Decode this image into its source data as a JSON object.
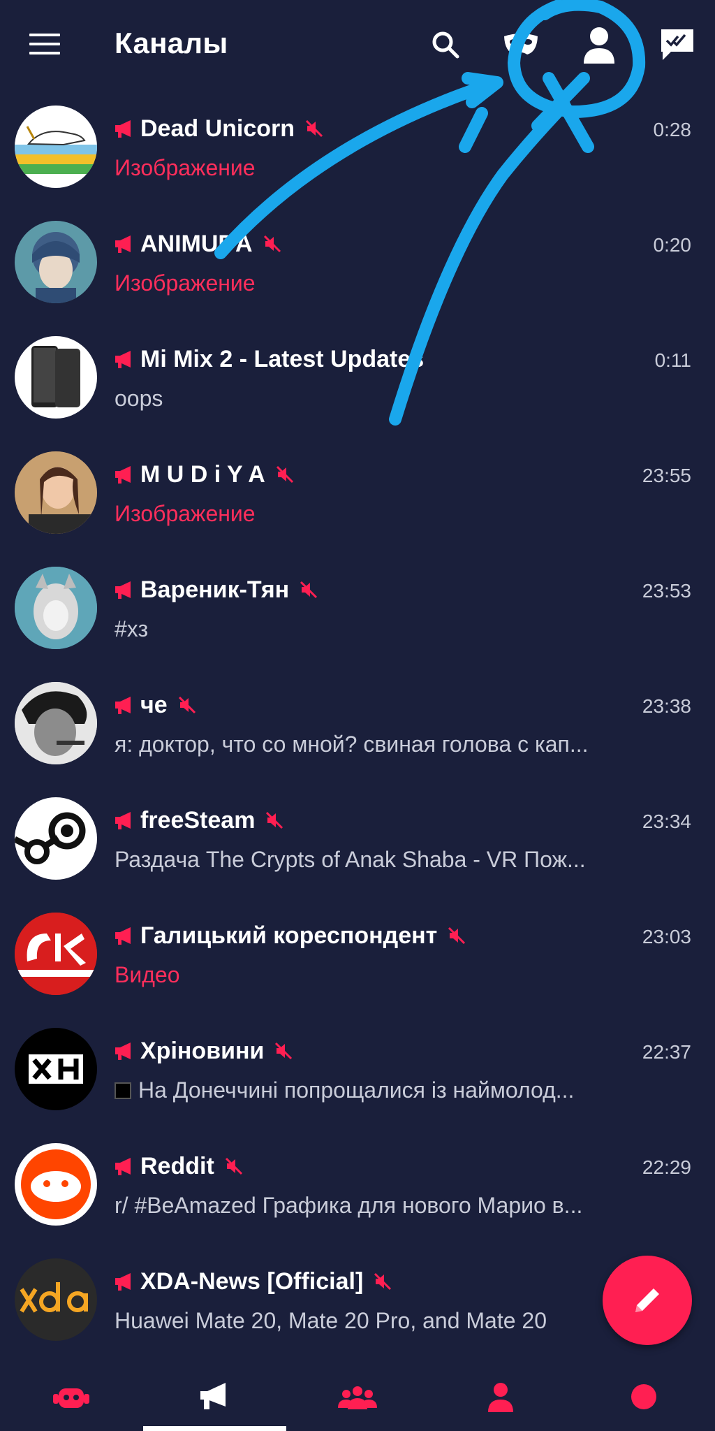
{
  "header": {
    "title": "Каналы",
    "icons": [
      "menu-icon",
      "search-icon",
      "mask-icon",
      "profile-icon",
      "mark-read-icon"
    ]
  },
  "colors": {
    "background": "#1a1f3b",
    "accent": "#ff1f52",
    "text_primary": "#ffffff",
    "text_secondary": "#c9ccd9",
    "annotation": "#1aa7ec"
  },
  "channels": [
    {
      "name": "Dead Unicorn",
      "time": "0:28",
      "preview": "Изображение",
      "media": true,
      "muted": true
    },
    {
      "name": "ANIMUDA",
      "time": "0:20",
      "preview": "Изображение",
      "media": true,
      "muted": true
    },
    {
      "name": "Mi Mix 2 - Latest Updates",
      "time": "0:11",
      "preview": "oops",
      "media": false,
      "muted": false
    },
    {
      "name": "M U D i Y A",
      "time": "23:55",
      "preview": "Изображение",
      "media": true,
      "muted": true
    },
    {
      "name": "Вареник-Тян",
      "time": "23:53",
      "preview": "#хз",
      "media": false,
      "muted": true
    },
    {
      "name": "че",
      "time": "23:38",
      "preview": "я: доктор, что со мной? свиная голова с кап...",
      "media": false,
      "muted": true
    },
    {
      "name": "freeSteam",
      "time": "23:34",
      "preview": "Раздача The Crypts of Anak Shaba - VR   Пож...",
      "media": false,
      "muted": true
    },
    {
      "name": "Галицький кореспондент",
      "time": "23:03",
      "preview": "Видео",
      "media": true,
      "muted": true
    },
    {
      "name": "Хріновини",
      "time": "22:37",
      "preview": "На Донеччині попрощалися із наймолод...",
      "media": false,
      "muted": true
    },
    {
      "name": "Reddit",
      "time": "22:29",
      "preview": "r/ #BeAmazed Графика для нового Марио в...",
      "media": false,
      "muted": true
    },
    {
      "name": "XDA-News [Official]",
      "time": "",
      "preview": "Huawei Mate 20, Mate 20 Pro, and Mate 20",
      "media": false,
      "muted": true
    }
  ],
  "fab": {
    "icon": "pencil-icon"
  },
  "bottom_nav": {
    "items": [
      "bot-icon",
      "channels-icon",
      "groups-icon",
      "contacts-icon",
      "dot-icon"
    ],
    "active_index": 1
  }
}
